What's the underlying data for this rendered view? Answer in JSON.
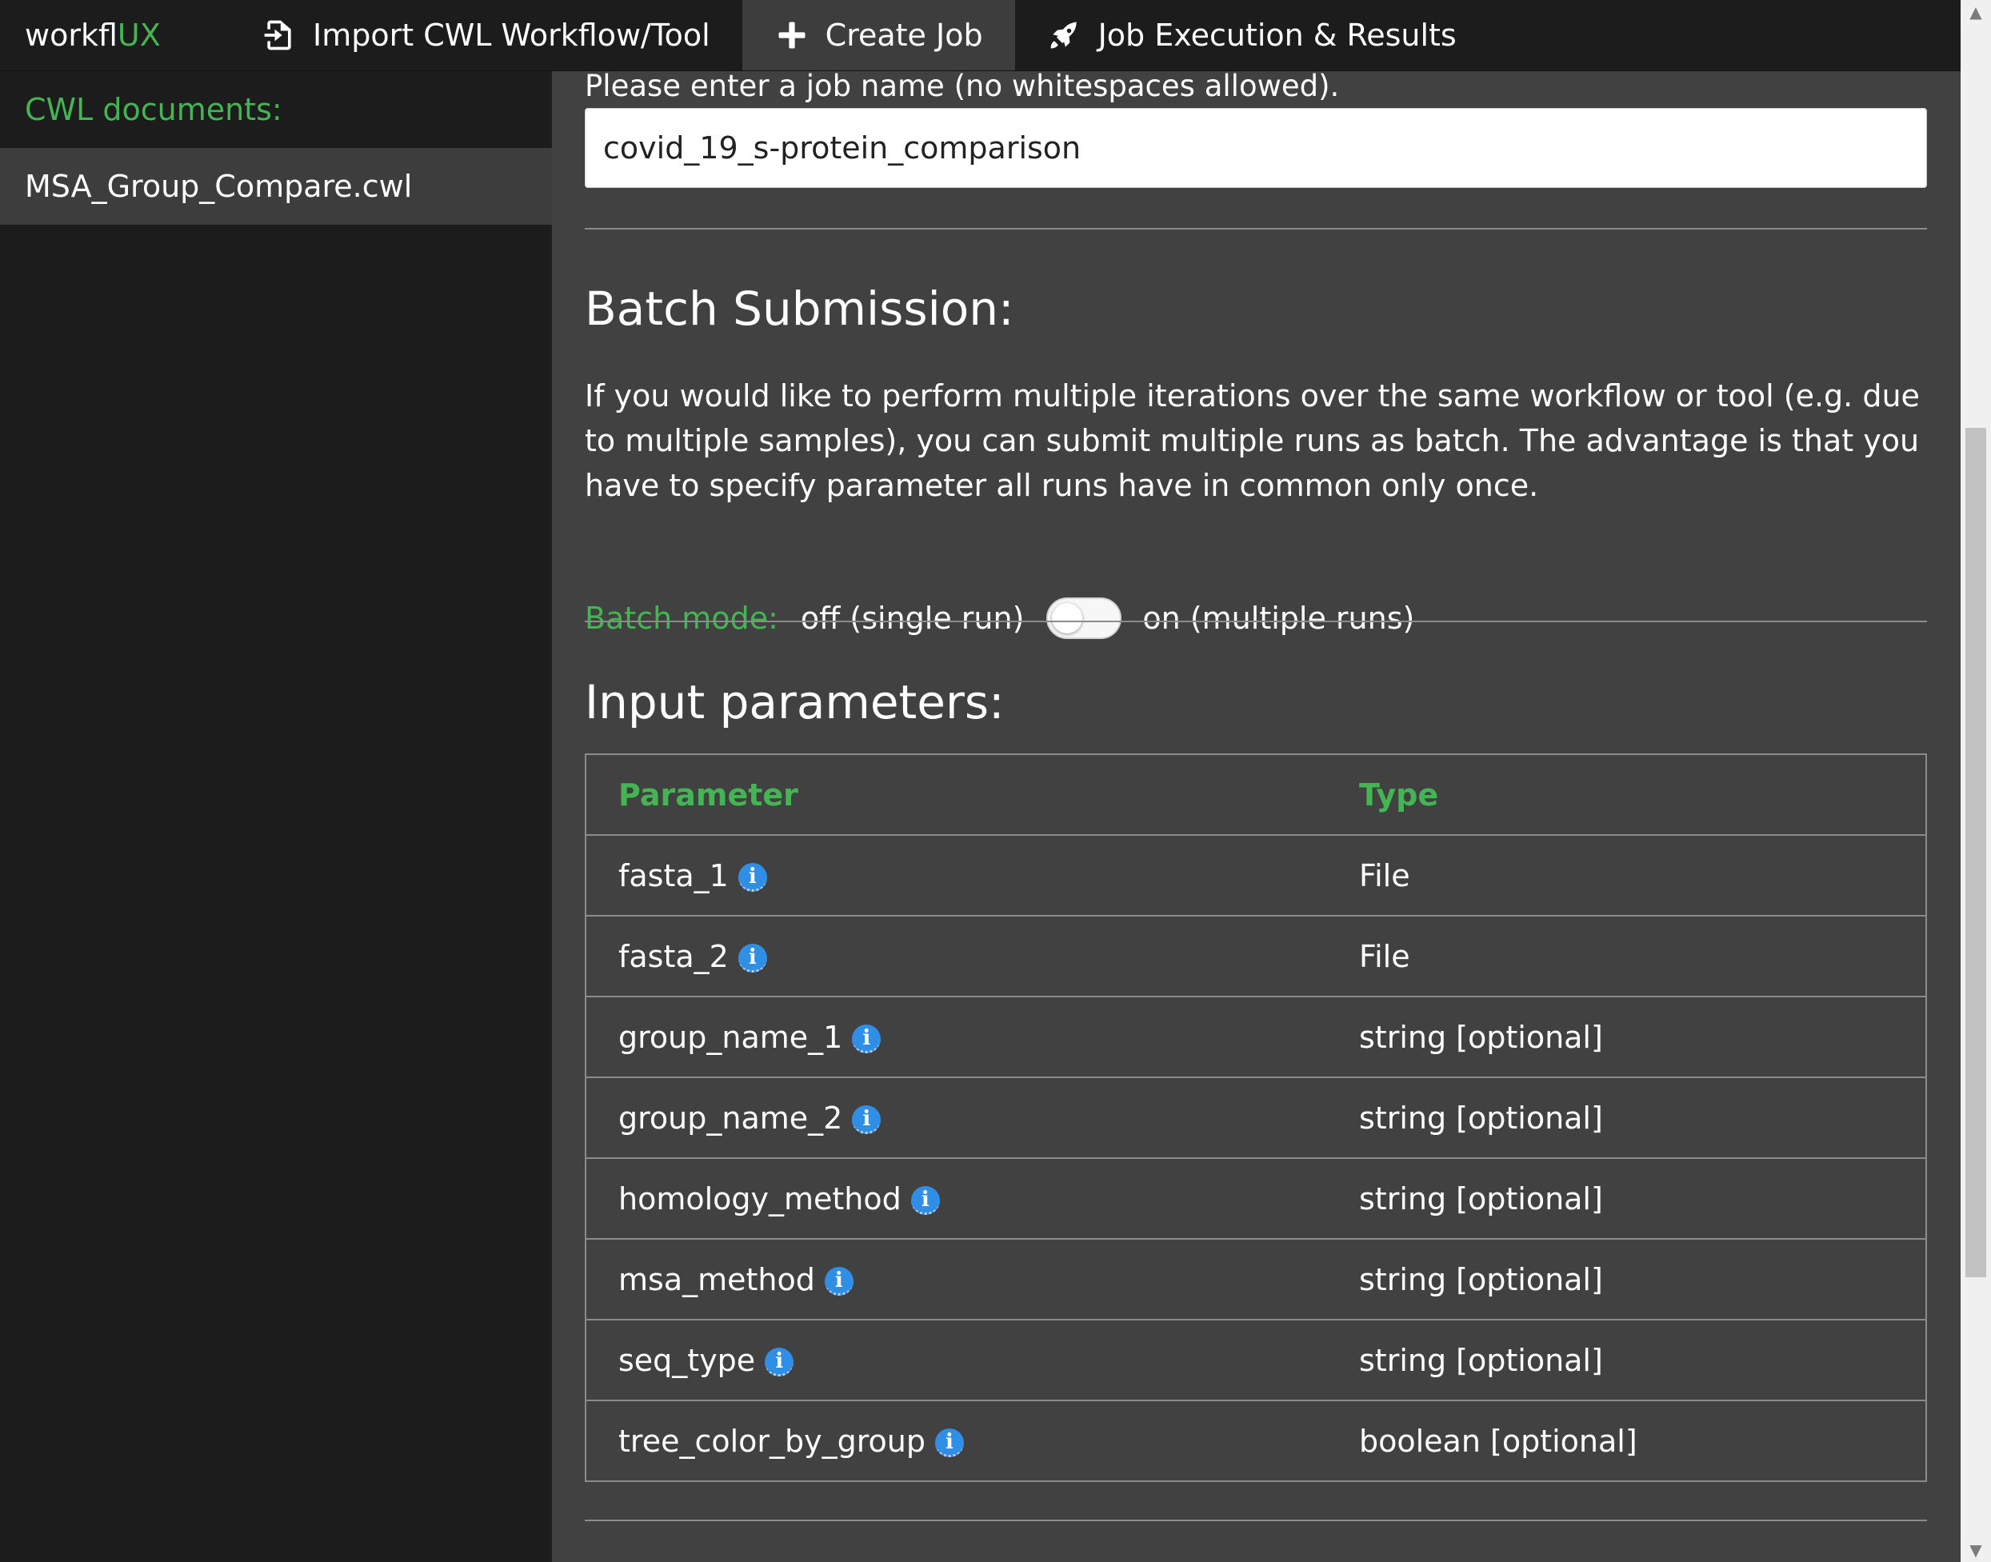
{
  "app": {
    "brand_main": "workfl",
    "brand_accent": "UX"
  },
  "nav": {
    "items": [
      {
        "label": "Import CWL Workflow/Tool",
        "icon": "import-icon"
      },
      {
        "label": "Create Job",
        "icon": "plus-icon",
        "active": true
      },
      {
        "label": "Job Execution & Results",
        "icon": "rocket-icon"
      }
    ]
  },
  "sidebar": {
    "heading": "CWL documents:",
    "documents": [
      "MSA_Group_Compare.cwl"
    ]
  },
  "job": {
    "prompt": "Please enter a job name (no whitespaces allowed).",
    "name_value": "covid_19_s-protein_comparison"
  },
  "batch": {
    "title": "Batch Submission:",
    "description": "If you would like to perform multiple iterations over the same workflow or tool (e.g. due to multiple samples), you can submit multiple runs as batch. The advantage is that you have to specify parameter all runs have in common only once.",
    "mode_label": "Batch mode:",
    "off_label": "off (single run)",
    "on_label": "on (multiple runs)",
    "enabled": false
  },
  "inputs": {
    "title": "Input parameters:",
    "columns": [
      "Parameter",
      "Type"
    ],
    "rows": [
      {
        "param": "fasta_1",
        "type": "File"
      },
      {
        "param": "fasta_2",
        "type": "File"
      },
      {
        "param": "group_name_1",
        "type": "string [optional]"
      },
      {
        "param": "group_name_2",
        "type": "string [optional]"
      },
      {
        "param": "homology_method",
        "type": "string [optional]"
      },
      {
        "param": "msa_method",
        "type": "string [optional]"
      },
      {
        "param": "seq_type",
        "type": "string [optional]"
      },
      {
        "param": "tree_color_by_group",
        "type": "boolean [optional]"
      }
    ]
  },
  "colors": {
    "accent": "#44b553",
    "info": "#2f8fe6",
    "panel": "#414141",
    "sidebar": "#1c1c1c"
  },
  "info_icon": {
    "glyph": "i",
    "name": "info-icon"
  }
}
